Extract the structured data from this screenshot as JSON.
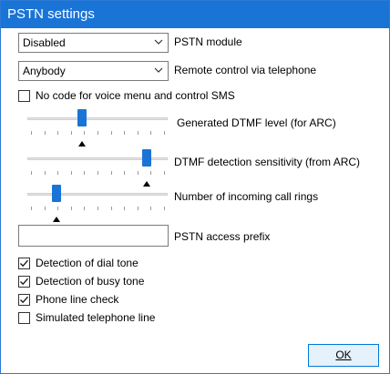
{
  "window": {
    "title": "PSTN settings"
  },
  "pstn_module": {
    "value": "Disabled",
    "label": "PSTN module"
  },
  "remote_control": {
    "value": "Anybody",
    "label": "Remote control via telephone"
  },
  "no_code": {
    "label": "No code for voice menu and control SMS",
    "checked": false
  },
  "sliders": [
    {
      "label": "Generated DTMF level (for ARC)",
      "level": 0.39
    },
    {
      "label": "DTMF detection sensitivity (from ARC)",
      "level": 0.85
    },
    {
      "label": "Number of incoming call rings",
      "level": 0.21
    }
  ],
  "prefix": {
    "label": "PSTN access prefix",
    "value": ""
  },
  "checks": [
    {
      "label": "Detection of dial tone",
      "checked": true
    },
    {
      "label": "Detection of busy tone",
      "checked": true
    },
    {
      "label": "Phone line check",
      "checked": true
    },
    {
      "label": "Simulated telephone line",
      "checked": false
    }
  ],
  "ok_button": {
    "label": "OK"
  },
  "colors": {
    "title_bar": "#1a74d6",
    "accent": "#1a74d6"
  },
  "icons": {
    "dropdown": "chevron-down-icon",
    "check": "check-icon",
    "slider_pointer": "triangle-up-icon"
  }
}
